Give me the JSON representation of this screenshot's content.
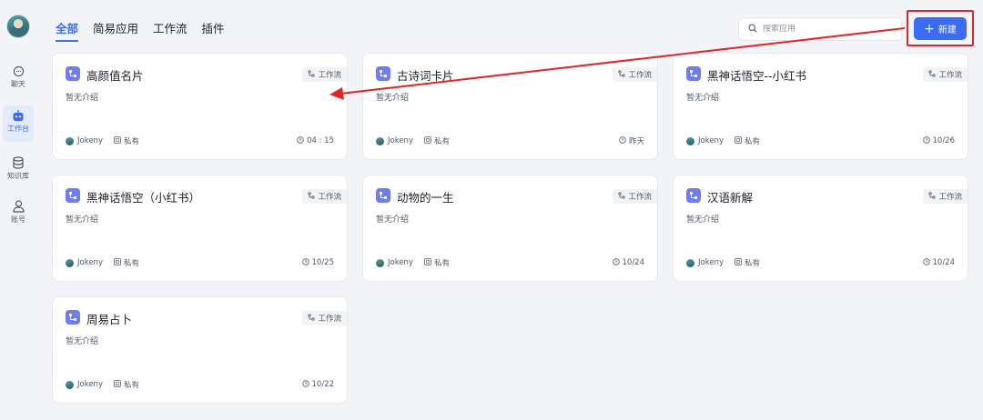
{
  "colors": {
    "accent": "#3b6cf6",
    "annotation": "#e0262a",
    "app_icon": "#6f7df0"
  },
  "sidebar": {
    "items": [
      {
        "label": "聊天",
        "icon": "chat-icon"
      },
      {
        "label": "工作台",
        "icon": "robot-icon",
        "active": true
      },
      {
        "label": "知识库",
        "icon": "database-icon"
      },
      {
        "label": "账号",
        "icon": "user-icon"
      }
    ]
  },
  "tabs": [
    {
      "label": "全部",
      "active": true
    },
    {
      "label": "简易应用"
    },
    {
      "label": "工作流"
    },
    {
      "label": "插件"
    }
  ],
  "search": {
    "placeholder": "搜索应用"
  },
  "toolbar": {
    "new_label": "新建"
  },
  "cards": [
    {
      "title": "高颜值名片",
      "type": "工作流",
      "desc": "暂无介绍",
      "user": "Jokeny",
      "visibility": "私有",
      "time": "04 : 15"
    },
    {
      "title": "古诗词卡片",
      "type": "工作流",
      "desc": "暂无介绍",
      "user": "Jokeny",
      "visibility": "私有",
      "time": "昨天"
    },
    {
      "title": "黑神话悟空--小红书",
      "type": "工作流",
      "desc": "暂无介绍",
      "user": "Jokeny",
      "visibility": "私有",
      "time": "10/26"
    },
    {
      "title": "黑神话悟空（小红书）",
      "type": "工作流",
      "desc": "暂无介绍",
      "user": "Jokeny",
      "visibility": "私有",
      "time": "10/25"
    },
    {
      "title": "动物的一生",
      "type": "工作流",
      "desc": "暂无介绍",
      "user": "Jokeny",
      "visibility": "私有",
      "time": "10/24"
    },
    {
      "title": "汉语新解",
      "type": "工作流",
      "desc": "暂无介绍",
      "user": "Jokeny",
      "visibility": "私有",
      "time": "10/24"
    },
    {
      "title": "周易占卜",
      "type": "工作流",
      "desc": "暂无介绍",
      "user": "Jokeny",
      "visibility": "私有",
      "time": "10/22"
    }
  ]
}
